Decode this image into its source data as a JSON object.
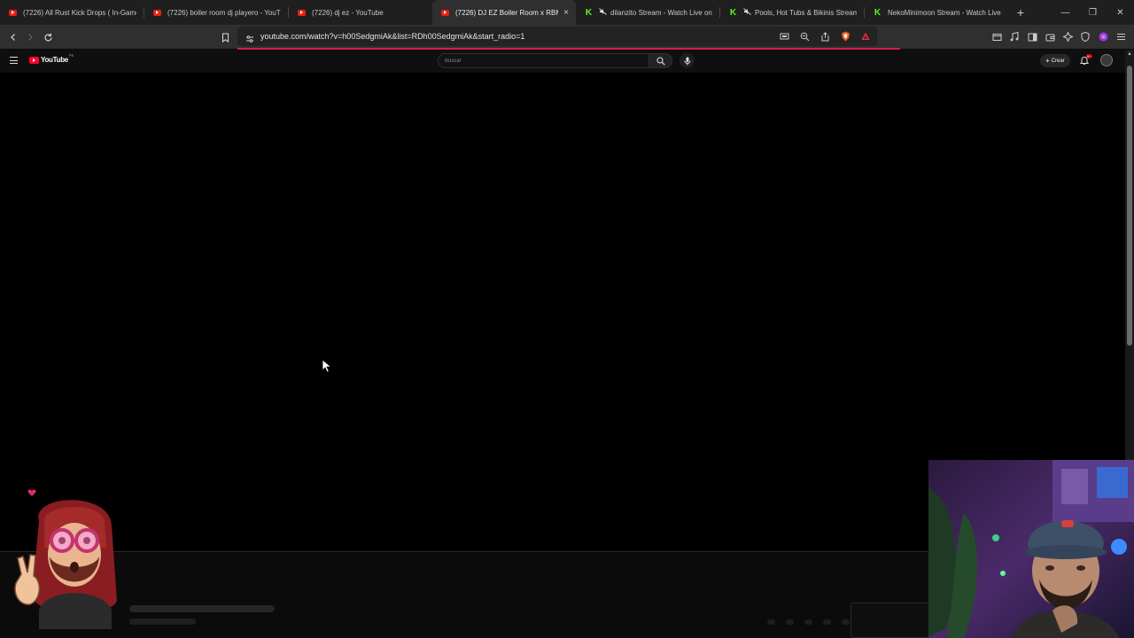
{
  "browser": {
    "tabs": [
      {
        "title": "(7226) All Rust Kick Drops ( In-Game",
        "icon": "youtube-favicon"
      },
      {
        "title": "(7226) boiler room dj playero - YouT",
        "icon": "youtube-favicon"
      },
      {
        "title": "(7226) dj ez - YouTube",
        "icon": "youtube-favicon"
      },
      {
        "title": "(7226) DJ EZ Boiler Room x RBM",
        "icon": "youtube-favicon",
        "active": true,
        "close": "×"
      },
      {
        "title": "dilanzito Stream - Watch Live on",
        "icon": "kick-favicon",
        "muted": true
      },
      {
        "title": "Pools, Hot Tubs & Bikinis Stream",
        "icon": "kick-favicon",
        "muted": true
      },
      {
        "title": "NekoMinimoon Stream - Watch Live",
        "icon": "kick-favicon"
      }
    ],
    "new_tab": "+",
    "window_controls": {
      "minimize": "—",
      "restore": "❐",
      "close": "✕"
    },
    "url": "youtube.com/watch?v=h00SedgmiAk&list=RDh00SedgmiAk&start_radio=1",
    "accent_color": "#d61d4b"
  },
  "youtube": {
    "logo_text": "YouTube",
    "country_code": "PE",
    "search_placeholder": "Buscar",
    "create_label": "Crear",
    "notification_badge": "9+"
  },
  "player": {
    "state": "loading / black frame"
  }
}
